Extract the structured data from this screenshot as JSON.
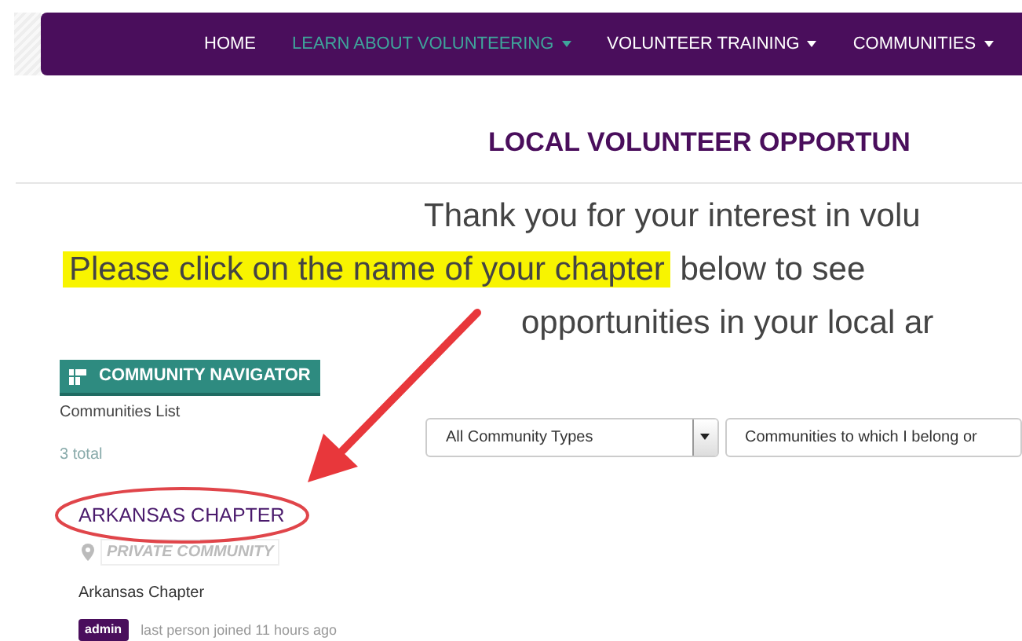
{
  "nav": {
    "items": [
      {
        "label": "HOME",
        "selected": false,
        "dropdown": false
      },
      {
        "label": "LEARN ABOUT VOLUNTEERING",
        "selected": true,
        "dropdown": true
      },
      {
        "label": "VOLUNTEER TRAINING",
        "selected": false,
        "dropdown": true
      },
      {
        "label": "COMMUNITIES",
        "selected": false,
        "dropdown": true
      }
    ]
  },
  "heading": "LOCAL VOLUNTEER OPPORTUN",
  "intro": {
    "line_1": "Thank you for your interest in volu",
    "line_2_highlight": "Please click on the name of your chapter",
    "line_2_rest": "below to see",
    "line_3": "opportunities in your local ar"
  },
  "navigator": {
    "title": "COMMUNITY NAVIGATOR",
    "subtitle": "Communities List",
    "count": "3 total"
  },
  "filters": [
    {
      "value": "All Community Types",
      "dropdown": true
    },
    {
      "value": "Communities to which I belong or",
      "dropdown": false
    }
  ],
  "communities": [
    {
      "name": "ARKANSAS CHAPTER",
      "privacy": "PRIVATE COMMUNITY",
      "description": "Arkansas Chapter",
      "role": "admin",
      "activity": "last person joined 11 hours ago"
    }
  ]
}
